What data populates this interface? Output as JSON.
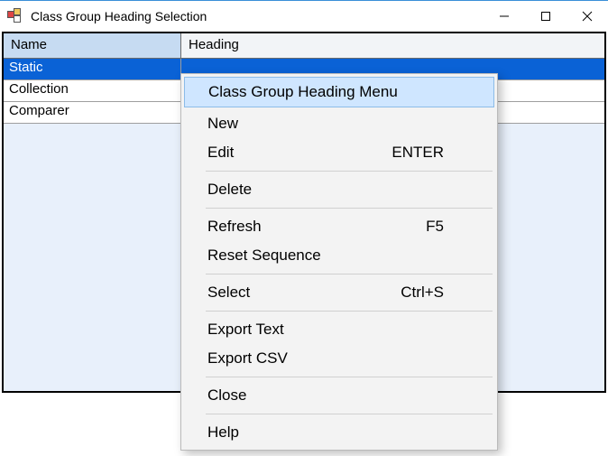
{
  "window": {
    "title": "Class Group Heading Selection"
  },
  "grid": {
    "columns": {
      "name": "Name",
      "heading": "Heading"
    },
    "rows": [
      {
        "name": "Static",
        "heading": "",
        "selected": true
      },
      {
        "name": "Collection",
        "heading": "",
        "selected": false
      },
      {
        "name": "Comparer",
        "heading": "",
        "selected": false
      }
    ]
  },
  "context_menu": {
    "title": "Class Group Heading Menu",
    "groups": [
      [
        {
          "label": "New",
          "accel": ""
        },
        {
          "label": "Edit",
          "accel": "ENTER"
        }
      ],
      [
        {
          "label": "Delete",
          "accel": ""
        }
      ],
      [
        {
          "label": "Refresh",
          "accel": "F5"
        },
        {
          "label": "Reset Sequence",
          "accel": ""
        }
      ],
      [
        {
          "label": "Select",
          "accel": "Ctrl+S"
        }
      ],
      [
        {
          "label": "Export Text",
          "accel": ""
        },
        {
          "label": "Export CSV",
          "accel": ""
        }
      ],
      [
        {
          "label": "Close",
          "accel": ""
        }
      ],
      [
        {
          "label": "Help",
          "accel": ""
        }
      ]
    ]
  }
}
